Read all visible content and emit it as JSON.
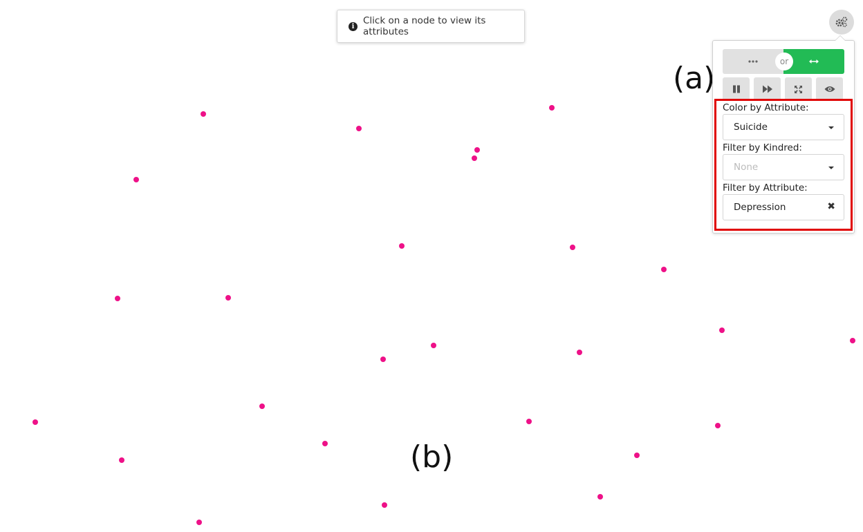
{
  "hint": {
    "text": "Click on a node to view its attributes",
    "icon": "info-circle-icon"
  },
  "annotations": {
    "a": "(a)",
    "b": "(b)"
  },
  "controls": {
    "toggle_icon": "gears-icon",
    "layout_toggle": {
      "left_icon": "ellipsis-icon",
      "or_label": "or",
      "right_icon": "arrows-horizontal-icon",
      "active": "right",
      "active_color": "#22bb55"
    },
    "tools": [
      {
        "name": "pause",
        "icon": "pause-icon"
      },
      {
        "name": "fast-forward",
        "icon": "fast-forward-icon"
      },
      {
        "name": "expand",
        "icon": "expand-icon"
      },
      {
        "name": "view",
        "icon": "eye-icon"
      }
    ],
    "color_by_attribute": {
      "label": "Color by Attribute:",
      "value": "Suicide"
    },
    "filter_by_kindred": {
      "label": "Filter by Kindred:",
      "placeholder": "None"
    },
    "filter_by_attribute": {
      "label": "Filter by Attribute:",
      "value": "Depression"
    },
    "highlight_color": "#e00000"
  },
  "graph": {
    "node_color": "#ee1188"
  }
}
